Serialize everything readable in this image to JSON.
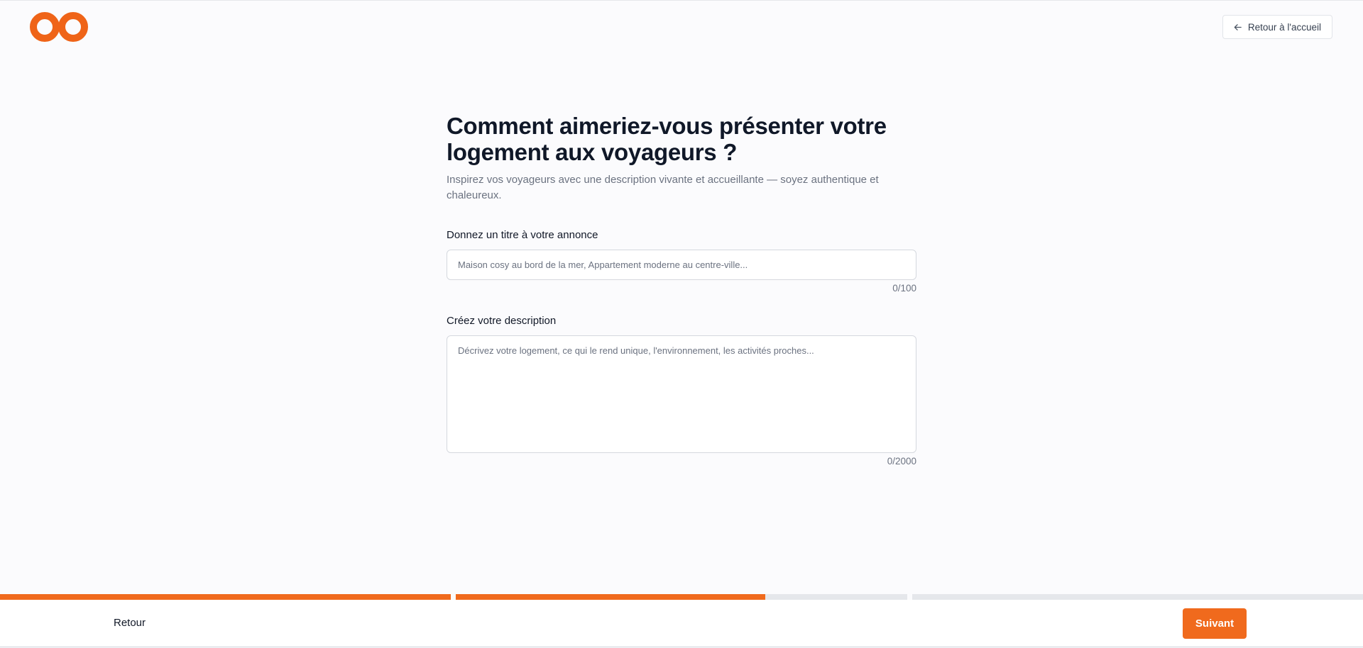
{
  "header": {
    "logo_icon": "infinity-logo-icon",
    "home_button_label": "Retour à l'accueil",
    "home_button_icon": "arrow-left-icon"
  },
  "main": {
    "title": "Comment aimeriez-vous présenter votre logement aux voyageurs ?",
    "subtitle": "Inspirez vos voyageurs avec une description vivante et accueillante — soyez authentique et chaleureux.",
    "title_field": {
      "label": "Donnez un titre à votre annonce",
      "value": "",
      "placeholder": "Maison cosy au bord de la mer, Appartement moderne au centre-ville...",
      "counter": "0/100"
    },
    "description_field": {
      "label": "Créez votre description",
      "value": "",
      "placeholder": "Décrivez votre logement, ce qui le rend unique, l'environnement, les activités proches...",
      "counter": "0/2000"
    }
  },
  "progress": {
    "steps": [
      1.0,
      0.68,
      0.0,
      0.0
    ]
  },
  "footer": {
    "back_label": "Retour",
    "next_label": "Suivant"
  },
  "colors": {
    "accent": "#f06a1d",
    "track": "#e5e7eb"
  }
}
